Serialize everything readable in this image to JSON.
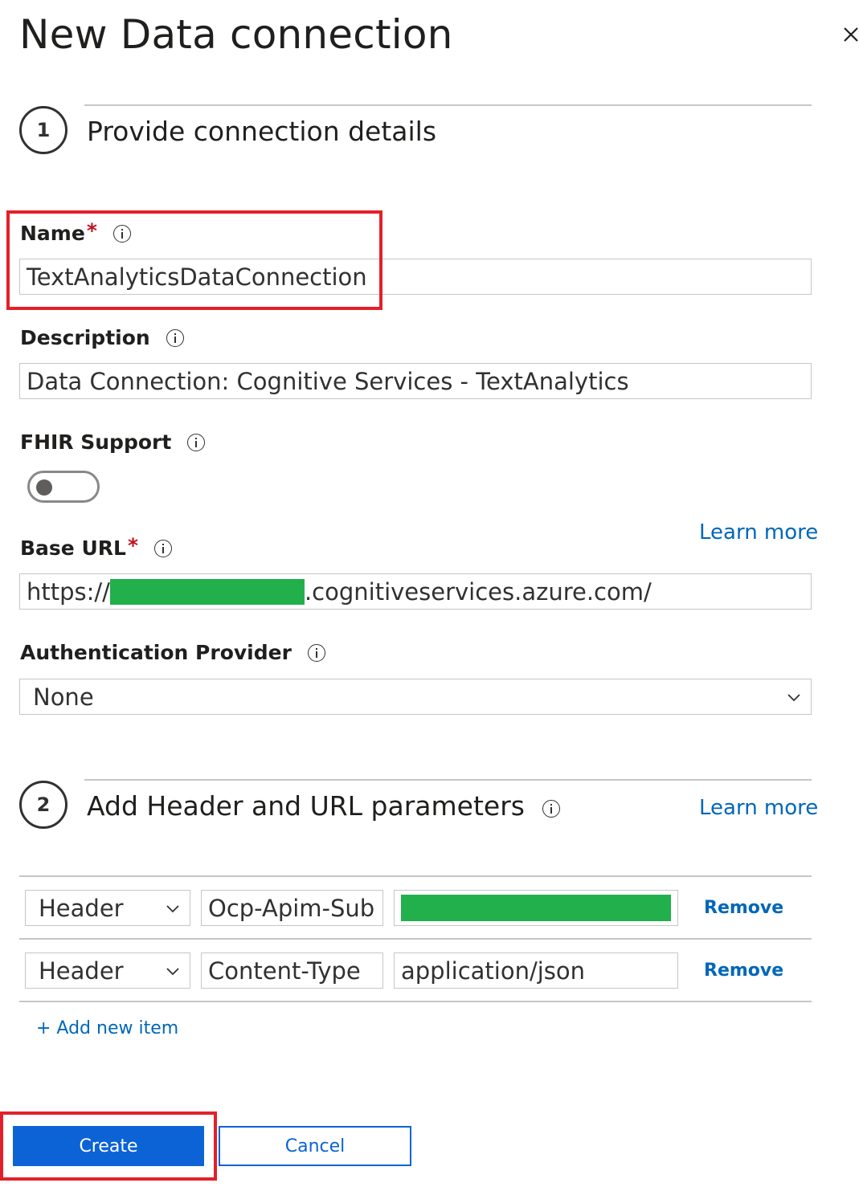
{
  "panel": {
    "title": "New Data connection",
    "close_icon": "close-icon"
  },
  "step1": {
    "number": "1",
    "title": "Provide connection details"
  },
  "fields": {
    "name": {
      "label": "Name",
      "required_mark": "*",
      "value": "TextAnalyticsDataConnection"
    },
    "description": {
      "label": "Description",
      "value": "Data Connection: Cognitive Services - TextAnalytics"
    },
    "fhir": {
      "label": "FHIR Support",
      "toggle_on": false
    },
    "base_url": {
      "label": "Base URL",
      "required_mark": "*",
      "learn_more": "Learn more",
      "value_prefix": "https://",
      "value_suffix": ".cognitiveservices.azure.com/"
    },
    "auth": {
      "label": "Authentication Provider",
      "value": "None"
    }
  },
  "step2": {
    "number": "2",
    "title": "Add Header and URL parameters",
    "learn_more": "Learn more"
  },
  "params": [
    {
      "type": "Header",
      "key": "Ocp-Apim-Sub",
      "value": "",
      "remove": "Remove"
    },
    {
      "type": "Header",
      "key": "Content-Type",
      "value": "application/json",
      "remove": "Remove"
    }
  ],
  "add_item": "+ Add new item",
  "buttons": {
    "create": "Create",
    "cancel": "Cancel"
  },
  "colors": {
    "link": "#0067b8",
    "primary": "#0b63d6",
    "required": "#c50f1f",
    "highlight": "#e3202a",
    "redaction": "#21b04b"
  }
}
